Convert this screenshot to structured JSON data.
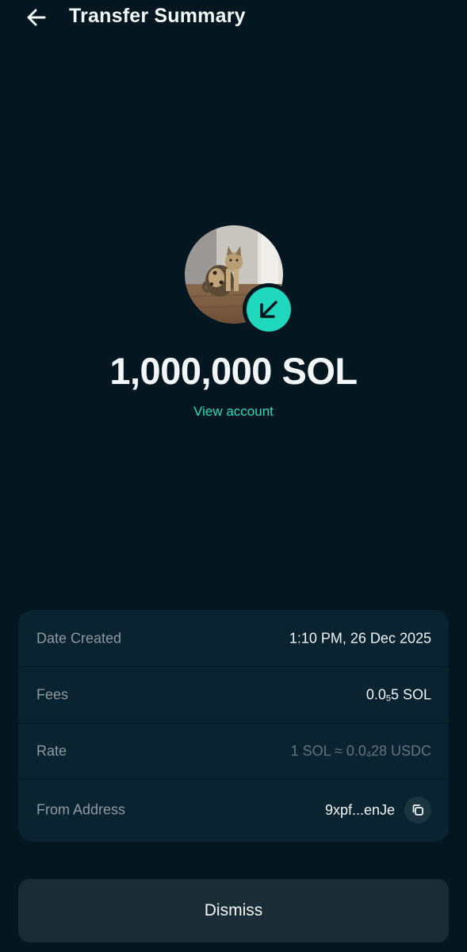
{
  "header": {
    "title": "Transfer Summary"
  },
  "transfer": {
    "amount": "1,000,000 SOL",
    "view_account_label": "View account"
  },
  "details": {
    "date_created": {
      "label": "Date Created",
      "value": "1:10 PM, 26 Dec 2025"
    },
    "fees": {
      "label": "Fees",
      "value_prefix": "0.0",
      "value_sub": "5",
      "value_suffix": "5 SOL"
    },
    "rate": {
      "label": "Rate",
      "value_prefix": "1 SOL ≈ 0.0",
      "value_sub": "4",
      "value_suffix": "28 USDC"
    },
    "from_address": {
      "label": "From Address",
      "value": "9xpf...enJe"
    }
  },
  "actions": {
    "dismiss_label": "Dismiss"
  },
  "colors": {
    "background": "#041720",
    "accent": "#1fd8be",
    "card": "#0a2330",
    "button": "#1a2c35"
  }
}
